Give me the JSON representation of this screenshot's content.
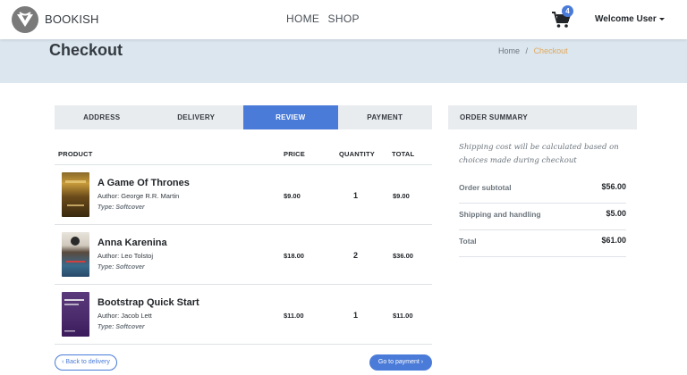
{
  "navbar": {
    "brand": "BOOKISH",
    "links": [
      "HOME",
      "SHOP"
    ],
    "cart_count": "4",
    "user_label": "Welcome User"
  },
  "hero": {
    "title": "Checkout",
    "breadcrumb": [
      "Home",
      "/",
      "Checkout"
    ]
  },
  "steps": [
    {
      "label": "ADDRESS",
      "active": false
    },
    {
      "label": "DELIVERY",
      "active": false
    },
    {
      "label": "REVIEW",
      "active": true
    },
    {
      "label": "PAYMENT",
      "active": false
    }
  ],
  "table": {
    "headers": [
      "PRODUCT",
      "PRICE",
      "QUANTITY",
      "TOTAL"
    ],
    "items": [
      {
        "title": "A Game Of Thrones",
        "author": "Author: George R.R. Martin",
        "type": "Type: Softcover",
        "price": "$9.00",
        "quantity": "1",
        "total": "$9.00"
      },
      {
        "title": "Anna Karenina",
        "author": "Author: Leo Tolstoj",
        "type": "Type: Softcover",
        "price": "$18.00",
        "quantity": "2",
        "total": "$36.00"
      },
      {
        "title": "Bootstrap Quick Start",
        "author": "Author: Jacob Lett",
        "type": "Type: Softcover",
        "price": "$11.00",
        "quantity": "1",
        "total": "$11.00"
      }
    ]
  },
  "buttons": {
    "back": "‹ Back to delivery",
    "next": "Go to payment ›"
  },
  "summary": {
    "heading": "ORDER SUMMARY",
    "note": "Shipping cost will be calculated based on choices made during checkout",
    "rows": [
      {
        "label": "Order subtotal",
        "value": "$56.00"
      },
      {
        "label": "Shipping and handling",
        "value": "$5.00"
      },
      {
        "label": "Total",
        "value": "$61.00"
      }
    ]
  },
  "colors": {
    "accent": "#4a7bd8",
    "hero_bg": "#dce6ef",
    "breadcrumb_active": "#e0a85a"
  }
}
